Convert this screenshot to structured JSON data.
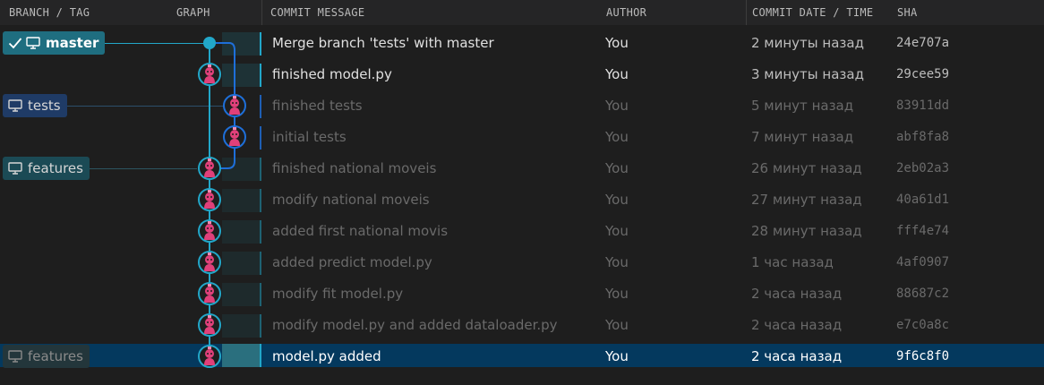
{
  "columns": {
    "branch": "BRANCH / TAG",
    "graph": "GRAPH",
    "message": "COMMIT MESSAGE",
    "author": "AUTHOR",
    "date": "COMMIT DATE / TIME",
    "sha": "SHA"
  },
  "refs": [
    {
      "label": "master",
      "checked": true,
      "color": "#1f6e80"
    },
    {
      "label": "tests",
      "checked": false,
      "color": "#1f3b66"
    },
    {
      "label": "features",
      "checked": false,
      "color": "#1b4a55"
    },
    {
      "label": "features",
      "checked": false,
      "color": "#23363b"
    }
  ],
  "commits": [
    {
      "message": "Merge branch 'tests' with master",
      "author": "You",
      "date": "2 минуты назад",
      "sha": "24e707a"
    },
    {
      "message": "finished model.py",
      "author": "You",
      "date": "3 минуты назад",
      "sha": "29cee59"
    },
    {
      "message": "finished tests",
      "author": "You",
      "date": "5 минут назад",
      "sha": "83911dd"
    },
    {
      "message": "initial tests",
      "author": "You",
      "date": "7 минут назад",
      "sha": "abf8fa8"
    },
    {
      "message": "finished national moveis",
      "author": "You",
      "date": "26 минут назад",
      "sha": "2eb02a3"
    },
    {
      "message": "modify national moveis",
      "author": "You",
      "date": "27 минут назад",
      "sha": "40a61d1"
    },
    {
      "message": "added first national movis",
      "author": "You",
      "date": "28 минут назад",
      "sha": "fff4e74"
    },
    {
      "message": "added predict model.py",
      "author": "You",
      "date": "1 час назад",
      "sha": "4af0907"
    },
    {
      "message": "modify fit model.py",
      "author": "You",
      "date": "2 часа назад",
      "sha": "88687c2"
    },
    {
      "message": "modify model.py and added dataloader.py",
      "author": "You",
      "date": "2 часа назад",
      "sha": "e7c0a8c"
    },
    {
      "message": "model.py added",
      "author": "You",
      "date": "2 часа назад",
      "sha": "9f6c8f0"
    }
  ],
  "colors": {
    "lane_master": "#22a7c9",
    "lane_tests": "#1e6fd9",
    "avatar": "#e0407a",
    "selected_row": "#04395e"
  },
  "icons": [
    "check-icon",
    "monitor-icon",
    "avatar-icon"
  ]
}
